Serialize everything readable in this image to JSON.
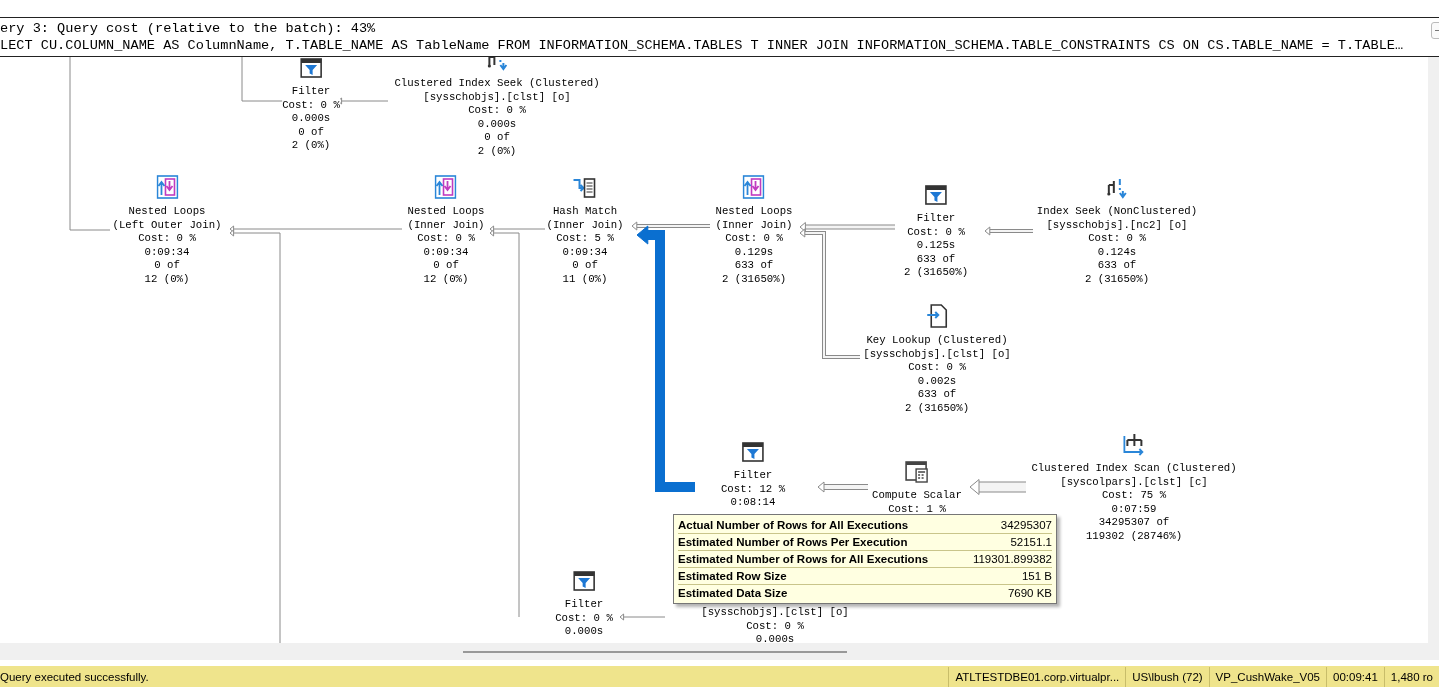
{
  "header": {
    "title": "ery 3: Query cost (relative to the batch): 43%",
    "query": "LECT CU.COLUMN_NAME AS ColumnName, T.TABLE_NAME AS TableName FROM INFORMATION_SCHEMA.TABLES T INNER JOIN INFORMATION_SCHEMA.TABLE_CONSTRAINTS CS ON CS.TABLE_NAME = T.TABLE…"
  },
  "plan_nodes": [
    {
      "kind": "filter",
      "lines": [
        "Filter",
        "Cost: 0 %",
        "0.000s",
        "0 of",
        "2 (0%)"
      ]
    },
    {
      "kind": "clustered_seek",
      "lines": [
        "Clustered Index Seek (Clustered)",
        "[sysschobjs].[clst] [o]",
        "Cost: 0 %",
        "0.000s",
        "0 of",
        "2 (0%)"
      ]
    },
    {
      "kind": "nested_loops",
      "lines": [
        "Nested Loops",
        "(Left Outer Join)",
        "Cost: 0 %",
        "0:09:34",
        "0 of",
        "12 (0%)"
      ]
    },
    {
      "kind": "nested_loops",
      "lines": [
        "Nested Loops",
        "(Inner Join)",
        "Cost: 0 %",
        "0:09:34",
        "0 of",
        "12 (0%)"
      ]
    },
    {
      "kind": "hash_match",
      "lines": [
        "Hash Match",
        "(Inner Join)",
        "Cost: 5 %",
        "0:09:34",
        "0 of",
        "11 (0%)"
      ]
    },
    {
      "kind": "nested_loops",
      "lines": [
        "Nested Loops",
        "(Inner Join)",
        "Cost: 0 %",
        "0.129s",
        "633 of",
        "2 (31650%)"
      ]
    },
    {
      "kind": "filter",
      "lines": [
        "Filter",
        "Cost: 0 %",
        "0.125s",
        "633 of",
        "2 (31650%)"
      ]
    },
    {
      "kind": "index_seek",
      "lines": [
        "Index Seek (NonClustered)",
        "[sysschobjs].[nc2] [o]",
        "Cost: 0 %",
        "0.124s",
        "633 of",
        "2 (31650%)"
      ]
    },
    {
      "kind": "key_lookup",
      "lines": [
        "Key Lookup (Clustered)",
        "[sysschobjs].[clst] [o]",
        "Cost: 0 %",
        "0.002s",
        "633 of",
        "2 (31650%)"
      ]
    },
    {
      "kind": "filter",
      "lines": [
        "Filter",
        "Cost: 12 %",
        "0:08:14"
      ]
    },
    {
      "kind": "compute_scalar",
      "lines": [
        "Compute Scalar",
        "Cost: 1 %"
      ]
    },
    {
      "kind": "clustered_scan",
      "lines": [
        "Clustered Index Scan (Clustered)",
        "[syscolpars].[clst] [c]",
        "Cost: 75 %",
        "0:07:59",
        "34295307 of",
        "119302 (28746%)"
      ]
    },
    {
      "kind": "filter",
      "lines": [
        "Filter",
        "Cost: 0 %",
        "0.000s"
      ]
    },
    {
      "kind": "hidden",
      "lines": [
        "[sysschobjs].[clst] [o]",
        "Cost: 0 %",
        "0.000s"
      ]
    }
  ],
  "tooltip": {
    "rows": [
      {
        "label": "Actual Number of Rows for All Executions",
        "value": "34295307"
      },
      {
        "label": "Estimated Number of Rows Per Execution",
        "value": "52151.1"
      },
      {
        "label": "Estimated Number of Rows for All Executions",
        "value": "119301.899382"
      },
      {
        "label": "Estimated Row Size",
        "value": "151 B"
      },
      {
        "label": "Estimated Data Size",
        "value": "7690 KB"
      }
    ]
  },
  "status_bar": {
    "message": "Query executed successfully.",
    "segments": [
      "ATLTESTDBE01.corp.virtualpr...",
      "US\\lbush (72)",
      "VP_CushWake_V05",
      "00:09:41",
      "1,480 ro"
    ]
  }
}
